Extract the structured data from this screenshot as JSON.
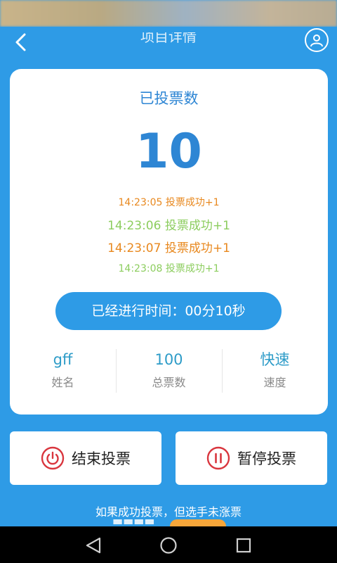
{
  "header": {
    "title": "项目详情",
    "back_icon": "chevron-left-icon",
    "user_icon": "user-icon"
  },
  "card": {
    "vote_title": "已投票数",
    "vote_count": "10",
    "log": [
      "14:23:05 投票成功+1",
      "14:23:06 投票成功+1",
      "14:23:07 投票成功+1",
      "14:23:08 投票成功+1"
    ],
    "elapsed": "已经进行时间：00分10秒",
    "stats": [
      {
        "value": "gff",
        "label": "姓名"
      },
      {
        "value": "100",
        "label": "总票数"
      },
      {
        "value": "快速",
        "label": "速度"
      }
    ]
  },
  "actions": {
    "end_label": "结束投票",
    "end_icon": "power-icon",
    "pause_label": "暂停投票",
    "pause_icon": "pause-icon"
  },
  "hint": {
    "line1": "如果成功投票，但选手未涨票"
  },
  "navbar": {
    "back_icon": "nav-back-icon",
    "home_icon": "nav-home-icon",
    "recents_icon": "nav-recents-icon"
  },
  "colors": {
    "primary": "#2e9be6",
    "accent_text": "#2e86d4",
    "log_orange": "#e8881e",
    "log_green": "#8ccd5e",
    "danger": "#d9363e"
  }
}
